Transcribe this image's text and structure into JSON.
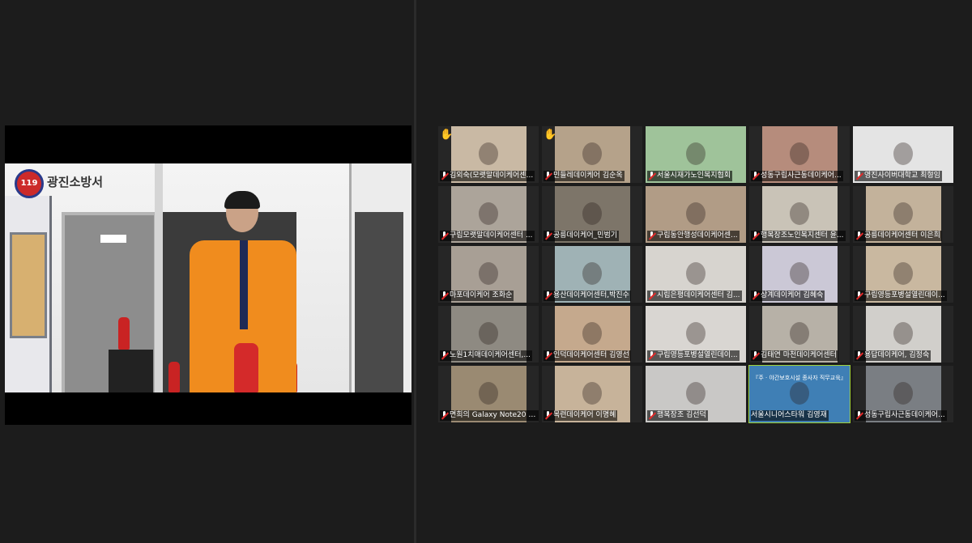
{
  "share": {
    "logo_badge": "119",
    "station_name": "광진소방서"
  },
  "participants": [
    {
      "name": "김외숙(모랫말데이케어센...",
      "hand": true,
      "video": "#c9b9a4",
      "muted": true
    },
    {
      "name": "민들레데이케어 김순옥",
      "hand": true,
      "video": "#b5a28a",
      "muted": true
    },
    {
      "name": "서울시재가노인복지협회",
      "hand": false,
      "video": "#9fc39a",
      "muted": true
    },
    {
      "name": "성동구립사근동데이케어...",
      "hand": false,
      "video": "#b68c7c",
      "muted": true
    },
    {
      "name": "영진사이버대학교 최형임",
      "hand": false,
      "video": "#e4e4e4",
      "muted": true
    },
    {
      "name": "구립모랫말데이케어센터 ...",
      "hand": false,
      "video": "#aca49a",
      "muted": true
    },
    {
      "name": "공릉데이케어_민범기",
      "hand": false,
      "video": "#7d7569",
      "muted": true
    },
    {
      "name": "구립동안행성데이케어센...",
      "hand": false,
      "video": "#b19c86",
      "muted": true
    },
    {
      "name": "행복장조노인복지센터 윤...",
      "hand": false,
      "video": "#c9c3b7",
      "muted": true
    },
    {
      "name": "공릉데이케어센터 이은희",
      "hand": false,
      "video": "#c3b29b",
      "muted": true
    },
    {
      "name": "마포데이케어 조화순",
      "hand": false,
      "video": "#a89f95",
      "muted": true
    },
    {
      "name": "용산데이케어센터,박진수",
      "hand": false,
      "video": "#9fb2b5",
      "muted": true
    },
    {
      "name": "시립은평데이케어센터 김...",
      "hand": false,
      "video": "#d7d4cf",
      "muted": true
    },
    {
      "name": "상계데이케어 김혜숙",
      "hand": false,
      "video": "#cbc8d6",
      "muted": true
    },
    {
      "name": "구립영등포병설열린데이...",
      "hand": false,
      "video": "#c9b8a0",
      "muted": true
    },
    {
      "name": "노원1치매데이케어센터,...",
      "hand": false,
      "video": "#8e8a82",
      "muted": true
    },
    {
      "name": "인덕데이케어센터 김영선",
      "hand": false,
      "video": "#c5a98d",
      "muted": true
    },
    {
      "name": "구립영등포병설열린데이...",
      "hand": false,
      "video": "#d9d6d2",
      "muted": true
    },
    {
      "name": "김태연 마천데이케어센터",
      "hand": false,
      "video": "#b7b1a7",
      "muted": true
    },
    {
      "name": "용답데이케어, 김정숙",
      "hand": false,
      "video": "#d1cfcb",
      "muted": true
    },
    {
      "name": "면희의 Galaxy Note20 5G",
      "hand": false,
      "video": "#9a8a72",
      "muted": true
    },
    {
      "name": "목련데이케어 이명혜",
      "hand": false,
      "video": "#c7b39a",
      "muted": true
    },
    {
      "name": "행복장조 김선덕",
      "hand": false,
      "video": "#c9c8c6",
      "muted": true
    },
    {
      "name": "서울시니어스타워 김영재",
      "hand": false,
      "video": "#3f7fb5",
      "muted": false
    },
    {
      "name": "성동구립사근동데이케어...",
      "hand": false,
      "video": "#7a7e83",
      "muted": true
    }
  ],
  "active_speaker_index": 23,
  "active_speaker_banner": "『주 · 야간보호시설 종사자 직무교육』"
}
